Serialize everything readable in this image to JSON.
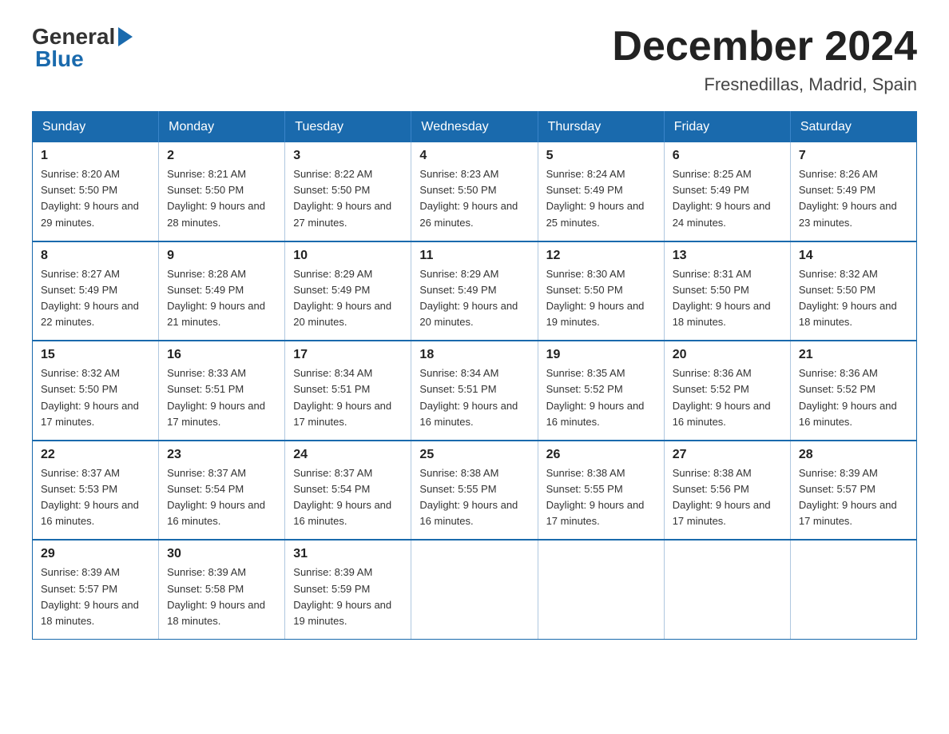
{
  "logo": {
    "general": "General",
    "blue": "Blue"
  },
  "title": "December 2024",
  "location": "Fresnedillas, Madrid, Spain",
  "days_of_week": [
    "Sunday",
    "Monday",
    "Tuesday",
    "Wednesday",
    "Thursday",
    "Friday",
    "Saturday"
  ],
  "weeks": [
    [
      {
        "day": "1",
        "sunrise": "8:20 AM",
        "sunset": "5:50 PM",
        "daylight": "9 hours and 29 minutes."
      },
      {
        "day": "2",
        "sunrise": "8:21 AM",
        "sunset": "5:50 PM",
        "daylight": "9 hours and 28 minutes."
      },
      {
        "day": "3",
        "sunrise": "8:22 AM",
        "sunset": "5:50 PM",
        "daylight": "9 hours and 27 minutes."
      },
      {
        "day": "4",
        "sunrise": "8:23 AM",
        "sunset": "5:50 PM",
        "daylight": "9 hours and 26 minutes."
      },
      {
        "day": "5",
        "sunrise": "8:24 AM",
        "sunset": "5:49 PM",
        "daylight": "9 hours and 25 minutes."
      },
      {
        "day": "6",
        "sunrise": "8:25 AM",
        "sunset": "5:49 PM",
        "daylight": "9 hours and 24 minutes."
      },
      {
        "day": "7",
        "sunrise": "8:26 AM",
        "sunset": "5:49 PM",
        "daylight": "9 hours and 23 minutes."
      }
    ],
    [
      {
        "day": "8",
        "sunrise": "8:27 AM",
        "sunset": "5:49 PM",
        "daylight": "9 hours and 22 minutes."
      },
      {
        "day": "9",
        "sunrise": "8:28 AM",
        "sunset": "5:49 PM",
        "daylight": "9 hours and 21 minutes."
      },
      {
        "day": "10",
        "sunrise": "8:29 AM",
        "sunset": "5:49 PM",
        "daylight": "9 hours and 20 minutes."
      },
      {
        "day": "11",
        "sunrise": "8:29 AM",
        "sunset": "5:49 PM",
        "daylight": "9 hours and 20 minutes."
      },
      {
        "day": "12",
        "sunrise": "8:30 AM",
        "sunset": "5:50 PM",
        "daylight": "9 hours and 19 minutes."
      },
      {
        "day": "13",
        "sunrise": "8:31 AM",
        "sunset": "5:50 PM",
        "daylight": "9 hours and 18 minutes."
      },
      {
        "day": "14",
        "sunrise": "8:32 AM",
        "sunset": "5:50 PM",
        "daylight": "9 hours and 18 minutes."
      }
    ],
    [
      {
        "day": "15",
        "sunrise": "8:32 AM",
        "sunset": "5:50 PM",
        "daylight": "9 hours and 17 minutes."
      },
      {
        "day": "16",
        "sunrise": "8:33 AM",
        "sunset": "5:51 PM",
        "daylight": "9 hours and 17 minutes."
      },
      {
        "day": "17",
        "sunrise": "8:34 AM",
        "sunset": "5:51 PM",
        "daylight": "9 hours and 17 minutes."
      },
      {
        "day": "18",
        "sunrise": "8:34 AM",
        "sunset": "5:51 PM",
        "daylight": "9 hours and 16 minutes."
      },
      {
        "day": "19",
        "sunrise": "8:35 AM",
        "sunset": "5:52 PM",
        "daylight": "9 hours and 16 minutes."
      },
      {
        "day": "20",
        "sunrise": "8:36 AM",
        "sunset": "5:52 PM",
        "daylight": "9 hours and 16 minutes."
      },
      {
        "day": "21",
        "sunrise": "8:36 AM",
        "sunset": "5:52 PM",
        "daylight": "9 hours and 16 minutes."
      }
    ],
    [
      {
        "day": "22",
        "sunrise": "8:37 AM",
        "sunset": "5:53 PM",
        "daylight": "9 hours and 16 minutes."
      },
      {
        "day": "23",
        "sunrise": "8:37 AM",
        "sunset": "5:54 PM",
        "daylight": "9 hours and 16 minutes."
      },
      {
        "day": "24",
        "sunrise": "8:37 AM",
        "sunset": "5:54 PM",
        "daylight": "9 hours and 16 minutes."
      },
      {
        "day": "25",
        "sunrise": "8:38 AM",
        "sunset": "5:55 PM",
        "daylight": "9 hours and 16 minutes."
      },
      {
        "day": "26",
        "sunrise": "8:38 AM",
        "sunset": "5:55 PM",
        "daylight": "9 hours and 17 minutes."
      },
      {
        "day": "27",
        "sunrise": "8:38 AM",
        "sunset": "5:56 PM",
        "daylight": "9 hours and 17 minutes."
      },
      {
        "day": "28",
        "sunrise": "8:39 AM",
        "sunset": "5:57 PM",
        "daylight": "9 hours and 17 minutes."
      }
    ],
    [
      {
        "day": "29",
        "sunrise": "8:39 AM",
        "sunset": "5:57 PM",
        "daylight": "9 hours and 18 minutes."
      },
      {
        "day": "30",
        "sunrise": "8:39 AM",
        "sunset": "5:58 PM",
        "daylight": "9 hours and 18 minutes."
      },
      {
        "day": "31",
        "sunrise": "8:39 AM",
        "sunset": "5:59 PM",
        "daylight": "9 hours and 19 minutes."
      },
      null,
      null,
      null,
      null
    ]
  ]
}
